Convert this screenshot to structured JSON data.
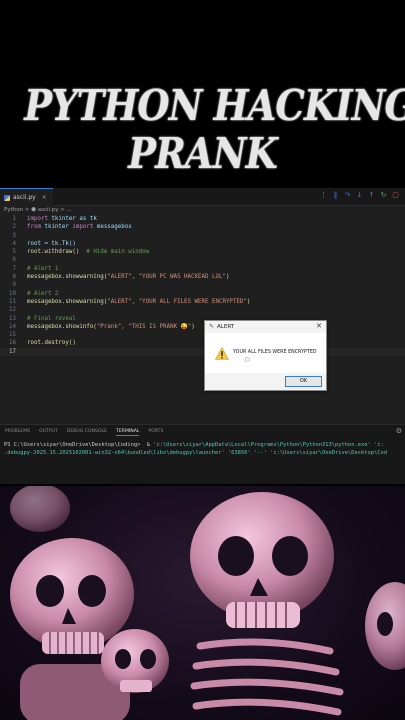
{
  "title": {
    "line1": "PYTHON HACKING",
    "line2": "PRANK"
  },
  "editor": {
    "tab_label": "ascii.py",
    "breadcrumb": "Python > ⬢ ascii.py > ...",
    "lines": [
      {
        "n": "1"
      },
      {
        "n": "2"
      },
      {
        "n": "3"
      },
      {
        "n": "4"
      },
      {
        "n": "5"
      },
      {
        "n": "6"
      },
      {
        "n": "7"
      },
      {
        "n": "8"
      },
      {
        "n": "9"
      },
      {
        "n": "10"
      },
      {
        "n": "11"
      },
      {
        "n": "12"
      },
      {
        "n": "13"
      },
      {
        "n": "14"
      },
      {
        "n": "15"
      },
      {
        "n": "16"
      },
      {
        "n": "17"
      }
    ],
    "code": {
      "l1_kw": "import",
      "l1_rest": " tkinter as tk",
      "l2_kw": "from",
      "l2_mod": " tkinter ",
      "l2_kw2": "import",
      "l2_rest": " messagebox",
      "l4": "root = tk.Tk()",
      "l5_a": "root.withdraw()",
      "l5_cm": "  # Hide main window",
      "l7": "# Alert 1",
      "l8_a": "messagebox.showwarning(",
      "l8_s": "\"ALERT\", \"YOUR PC WAS HACKEAD LOL\"",
      "l8_b": ")",
      "l10": "# Alert 2",
      "l11_a": "messagebox.showwarning(",
      "l11_s": "\"ALERT\", \"YOUR ALL FILES WERE ENCRYPTED\"",
      "l11_b": ")",
      "l13": "# Final reveal",
      "l14_a": "messagebox.showinfo(",
      "l14_s": "\"Prank\", \"THIS IS PRANK 😜\"",
      "l14_b": ")",
      "l16": "root.destroy()"
    }
  },
  "panel": {
    "tabs": [
      "PROBLEMS",
      "OUTPUT",
      "DEBUG CONSOLE",
      "TERMINAL",
      "PORTS"
    ],
    "active_tab": "TERMINAL",
    "term_line1_a": "PS C:\\Users\\siyar\\OneDrive\\Desktop\\Coding>  & ",
    "term_line1_b": "'c:\\Users\\siyar\\AppData\\Local\\Programs\\Python\\Python313\\python.exe' 'c:",
    "term_line2": ".debugpy-2025.15.2025102001-win32-x64\\bundled\\libs\\debugpy\\launcher' '63850' '--' 'c:\\Users\\siyar\\OneDrive\\Desktop\\Cod"
  },
  "dialog": {
    "title": "ALERT",
    "message": "YOUR ALL FILES WERE ENCRYPTED",
    "ok_label": "OK",
    "close": "✕"
  },
  "colors": {
    "accent": "#3a7bd5",
    "warning": "#f2c94c"
  }
}
